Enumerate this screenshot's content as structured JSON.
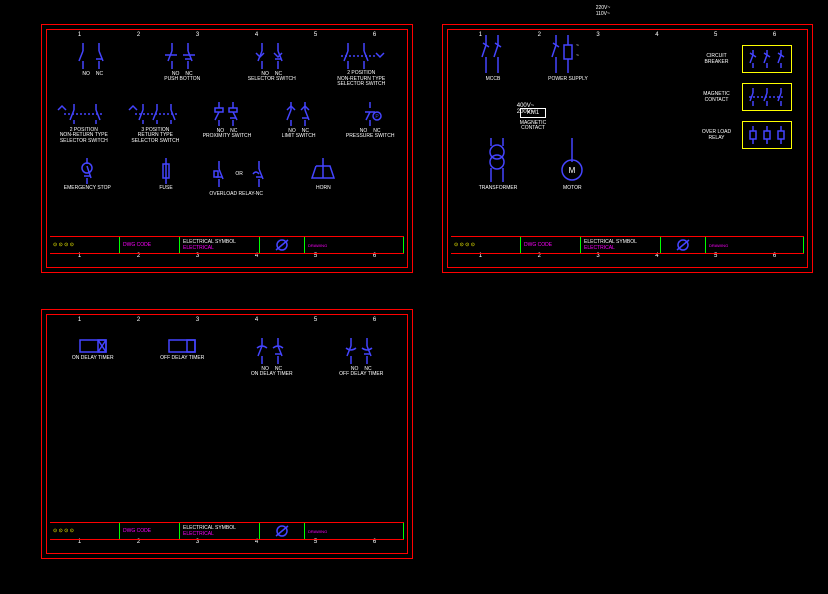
{
  "ruler": [
    "1",
    "2",
    "3",
    "4",
    "5",
    "6"
  ],
  "sheet1": {
    "row1": [
      {
        "labels": [
          "NO",
          "NC"
        ],
        "name": "NO/NC contact"
      },
      {
        "labels": [
          "NO",
          "NC"
        ],
        "sub": "PUSH BOTTON",
        "name": "push button"
      },
      {
        "labels": [
          "NO",
          "NC"
        ],
        "sub": "SELECTOR SWITCH",
        "name": "selector switch"
      },
      {
        "sub": "2 POSITION\nNON-RETURN TYPE\nSELECTOR SWITCH",
        "name": "2pos non-return selector"
      }
    ],
    "row2": [
      {
        "sub": "2 POSITION\nNON-RETURN TYPE\nSELECTOR SWITCH",
        "name": "2pos non-return selector-b"
      },
      {
        "sub": "3 POSITION\nRETURN TYPE\nSELECTOR SWITCH",
        "name": "3pos return selector"
      },
      {
        "labels": [
          "NO",
          "NC"
        ],
        "sub": "PROXIMITY SWITCH",
        "name": "proximity switch"
      },
      {
        "labels": [
          "NO",
          "NC"
        ],
        "sub": "LIMIT SWITCH",
        "name": "limit switch"
      },
      {
        "labels": [
          "NO",
          "NC"
        ],
        "sub": "PRESSURE SWITCH",
        "name": "pressure switch"
      }
    ],
    "row3": [
      {
        "sub": "EMERGENCY STOP",
        "name": "emergency stop"
      },
      {
        "sub": "FUSE",
        "name": "fuse"
      },
      {
        "mid": "OR",
        "sub": "OVERLOAD RELAY-NC",
        "name": "overload relay nc"
      },
      {
        "sub": "HORN",
        "name": "horn"
      }
    ],
    "tb": {
      "code": "DWG CODE",
      "title": "ELECTRICAL SYMBOL",
      "sub": "ELECTRICAL"
    }
  },
  "sheet2": {
    "mccb": "MCCB",
    "power": "POWER SUPPLY",
    "v1": "220V~",
    "v2": "110V~",
    "km": "KM1",
    "km_sub": "MAGNETIC\nCONTACT",
    "tv1": "400V~",
    "tv2": "200V~",
    "trans": "TRANSFORMER",
    "motor": "MOTOR",
    "motor_sym": "M",
    "legend": [
      {
        "name": "circuit-breaker",
        "label": "CIRCUIT\nBREAKER"
      },
      {
        "name": "magnetic-contact",
        "label": "MAGNETIC\nCONTACT"
      },
      {
        "name": "overload-relay",
        "label": "OVER LOAD\nRELAY"
      }
    ],
    "tb": {
      "code": "DWG CODE",
      "title": "ELECTRICAL SYMBOL",
      "sub": "ELECTRICAL"
    }
  },
  "sheet3": {
    "items": [
      {
        "name": "on-delay-timer-box",
        "label": "ON DELAY TIMER",
        "box": true,
        "fill": false
      },
      {
        "name": "off-delay-timer-box",
        "label": "OFF DELAY TIMER",
        "box": true,
        "fill": true
      },
      {
        "name": "on-delay-contacts",
        "labels": [
          "NO",
          "NC"
        ],
        "sub": "ON DELAY TIMER"
      },
      {
        "name": "off-delay-contacts",
        "labels": [
          "NO",
          "NC"
        ],
        "sub": "OFF DELAY TIMER"
      }
    ],
    "tb": {
      "code": "DWG CODE",
      "title": "ELECTRICAL SYMBOL",
      "sub": "ELECTRICAL"
    }
  }
}
